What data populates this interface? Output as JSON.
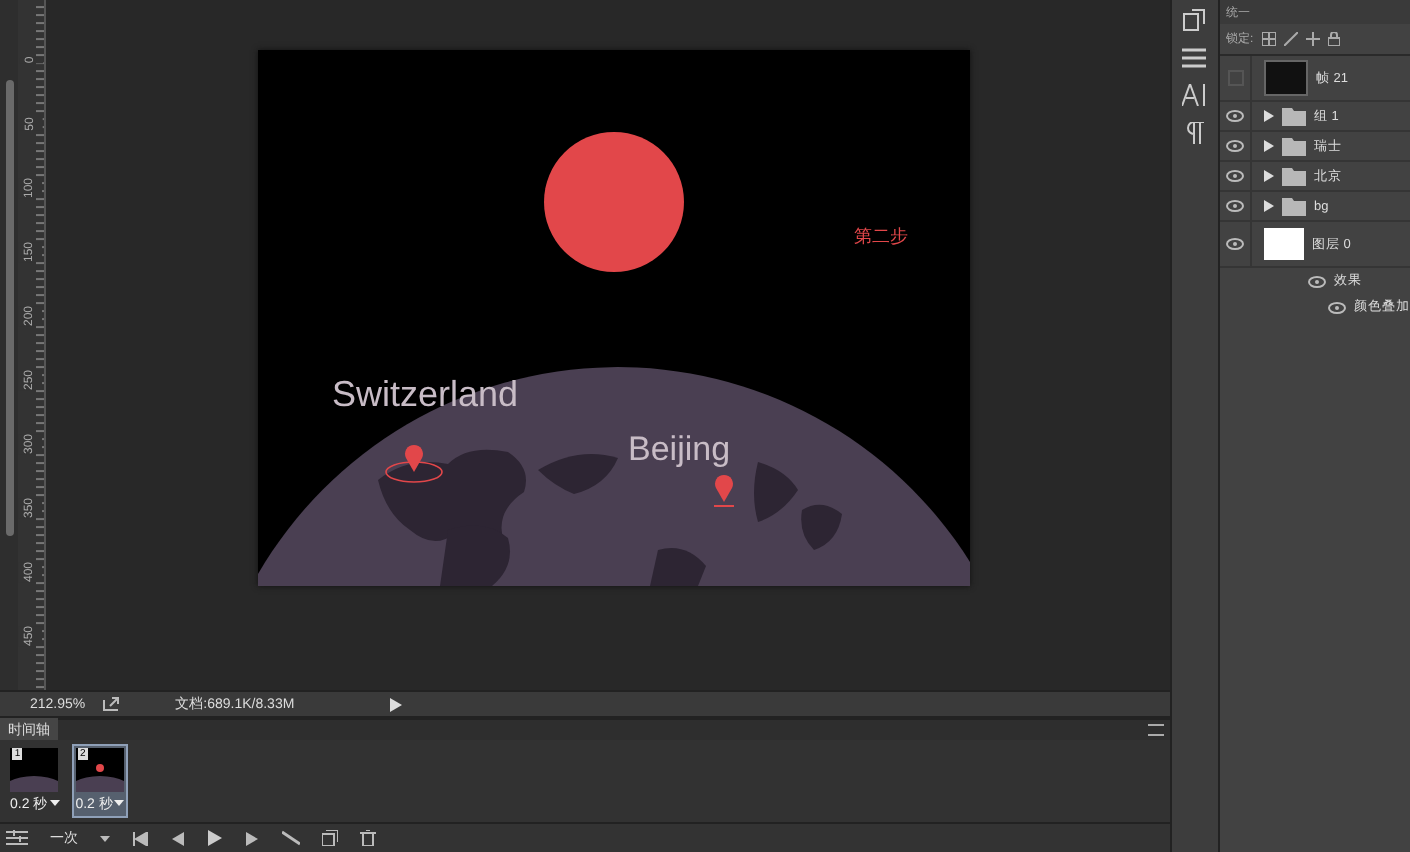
{
  "ruler": {
    "labels": [
      "0",
      "50",
      "100",
      "150",
      "200",
      "250",
      "300",
      "350",
      "400",
      "450"
    ]
  },
  "document": {
    "step_label": "第二步",
    "places": [
      {
        "name": "Switzerland"
      },
      {
        "name": "Beijing"
      }
    ]
  },
  "status_bar": {
    "zoom": "212.95%",
    "doc_info": "文档:689.1K/8.33M"
  },
  "timeline": {
    "title": "时间轴",
    "loop": "一次",
    "frames": [
      {
        "number": "1",
        "delay": "0.2 秒",
        "selected": false,
        "shows_sun": false
      },
      {
        "number": "2",
        "delay": "0.2 秒",
        "selected": true,
        "shows_sun": true
      }
    ]
  },
  "layers_panel": {
    "unify_label": "统一",
    "lock_label": "锁定:",
    "layers": [
      {
        "name": "帧 21",
        "kind": "image",
        "visible": false
      },
      {
        "name": "组 1",
        "kind": "group",
        "visible": true
      },
      {
        "name": "瑞士",
        "kind": "group",
        "visible": true
      },
      {
        "name": "北京",
        "kind": "group",
        "visible": true
      },
      {
        "name": "bg",
        "kind": "group",
        "visible": true
      },
      {
        "name": "图层 0",
        "kind": "fill",
        "visible": true,
        "children": [
          {
            "name": "效果",
            "visible": true,
            "children": [
              {
                "name": "颜色叠加",
                "visible": true
              }
            ]
          }
        ]
      }
    ]
  }
}
